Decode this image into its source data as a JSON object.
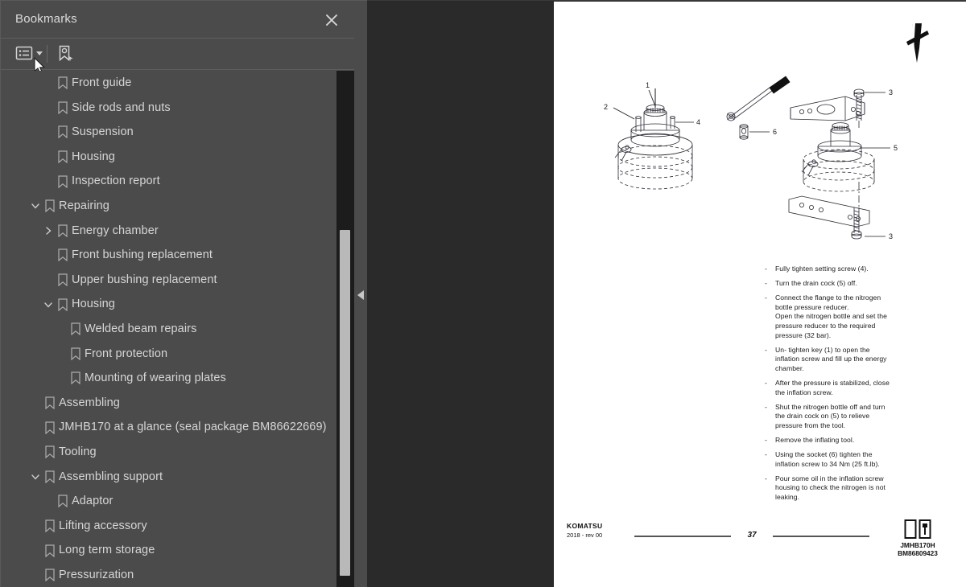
{
  "panel": {
    "title": "Bookmarks",
    "close_icon": "close-icon",
    "toolbar": {
      "options_icon": "list-options-icon",
      "options_caret_icon": "chevron-down-icon",
      "new_bookmark_icon": "new-bookmark-icon"
    },
    "collapse_icon": "chevron-left-icon",
    "cursor_icon": "mouse-pointer-icon"
  },
  "bookmarks": [
    {
      "label": "Front guide",
      "level": 2,
      "chevron": "none"
    },
    {
      "label": "Side rods and nuts",
      "level": 2,
      "chevron": "none"
    },
    {
      "label": "Suspension",
      "level": 2,
      "chevron": "none"
    },
    {
      "label": "Housing",
      "level": 2,
      "chevron": "none"
    },
    {
      "label": "Inspection report",
      "level": 2,
      "chevron": "none"
    },
    {
      "label": "Repairing",
      "level": 1,
      "chevron": "down"
    },
    {
      "label": "Energy chamber",
      "level": 2,
      "chevron": "right"
    },
    {
      "label": "Front bushing replacement",
      "level": 2,
      "chevron": "none"
    },
    {
      "label": "Upper bushing replacement",
      "level": 2,
      "chevron": "none"
    },
    {
      "label": "Housing",
      "level": 2,
      "chevron": "down"
    },
    {
      "label": "Welded beam repairs",
      "level": 3,
      "chevron": "none"
    },
    {
      "label": "Front protection",
      "level": 3,
      "chevron": "none"
    },
    {
      "label": "Mounting of wearing plates",
      "level": 3,
      "chevron": "none"
    },
    {
      "label": "Assembling",
      "level": 1,
      "chevron": "none"
    },
    {
      "label": "JMHB170 at a glance (seal package BM86622669)",
      "level": 1,
      "chevron": "none"
    },
    {
      "label": "Tooling",
      "level": 1,
      "chevron": "none"
    },
    {
      "label": "Assembling support",
      "level": 1,
      "chevron": "down"
    },
    {
      "label": "Adaptor",
      "level": 2,
      "chevron": "none"
    },
    {
      "label": "Lifting accessory",
      "level": 1,
      "chevron": "none"
    },
    {
      "label": "Long term storage",
      "level": 1,
      "chevron": "none"
    },
    {
      "label": "Pressurization",
      "level": 1,
      "chevron": "none"
    }
  ],
  "document": {
    "corner_icon": "chisel-tool-icon",
    "callouts": [
      "1",
      "2",
      "3",
      "4",
      "5",
      "6"
    ],
    "instructions": [
      {
        "dash": "-",
        "text": "Fully tighten setting screw (4)."
      },
      {
        "dash": "-",
        "text": "Turn the drain cock (5) off."
      },
      {
        "dash": "-",
        "text": "Connect the flange to the nitrogen\nbottle pressure reducer.\nOpen the nitrogen bottle and set the\npressure reducer to the required\npressure (32 bar)."
      },
      {
        "dash": "-",
        "text": "Un- tighten key (1) to open the\ninflation screw and fill up the energy\nchamber."
      },
      {
        "dash": "-",
        "text": "After the pressure is stabilized, close\nthe inflation screw."
      },
      {
        "dash": "-",
        "text": "Shut the nitrogen bottle off and turn\nthe drain cock on (5) to relieve\npressure from the tool."
      },
      {
        "dash": "-",
        "text": "Remove the inflating tool."
      },
      {
        "dash": "-",
        "text": "Using the socket (6) tighten the\ninflation screw to 34 Nm  (25 ft.lb)."
      },
      {
        "dash": "-",
        "text": "Pour some oil in the inflation screw\nhousing to check the nitrogen is not\nleaking."
      }
    ],
    "footer": {
      "brand": "KOMATSU",
      "revision": "2018 -  rev 00",
      "page_number": "37",
      "doc_model": "JMHB170H",
      "doc_code": "BM86809423",
      "book_icon": "open-book-icon"
    }
  },
  "colors": {
    "panel_bg": "#4b4b4b",
    "viewer_bg": "#2a2a2a",
    "page_bg": "#ffffff",
    "text": "#d6d6d6",
    "scrollbar_thumb": "#b9b9b9",
    "scrollbar_track": "#1c1c1c"
  }
}
